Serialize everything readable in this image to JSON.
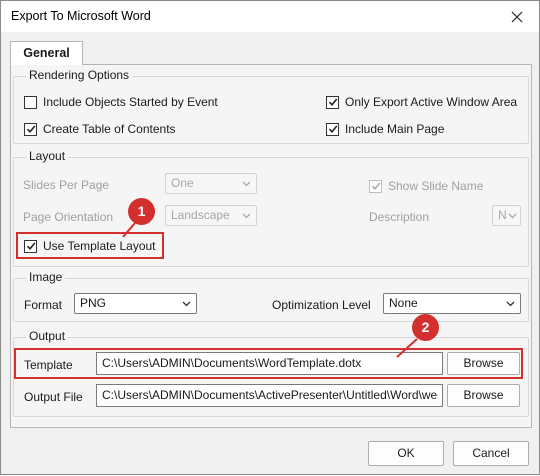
{
  "window": {
    "title": "Export To Microsoft Word"
  },
  "tabs": [
    {
      "label": "General"
    }
  ],
  "rendering": {
    "title": "Rendering Options",
    "include_objects": {
      "label": "Include Objects Started by Event",
      "checked": false
    },
    "only_active_window": {
      "label": "Only Export Active Window Area",
      "checked": true
    },
    "create_toc": {
      "label": "Create Table of Contents",
      "checked": true
    },
    "include_main_page": {
      "label": "Include Main Page",
      "checked": true
    }
  },
  "layout": {
    "title": "Layout",
    "slides_per_page": {
      "label": "Slides Per Page",
      "value": "One"
    },
    "show_slide_name": {
      "label": "Show Slide Name",
      "checked": true
    },
    "page_orientation": {
      "label": "Page Orientation",
      "value": "Landscape"
    },
    "description": {
      "label": "Description",
      "value": "N"
    },
    "use_template_layout": {
      "label": "Use Template Layout",
      "checked": true
    }
  },
  "image": {
    "title": "Image",
    "format": {
      "label": "Format",
      "value": "PNG"
    },
    "optimization": {
      "label": "Optimization Level",
      "value": "None"
    }
  },
  "output": {
    "title": "Output",
    "template": {
      "label": "Template",
      "value": "C:\\Users\\ADMIN\\Documents\\WordTemplate.dotx",
      "button": "Browse"
    },
    "output_file": {
      "label": "Output File",
      "value": "C:\\Users\\ADMIN\\Documents\\ActivePresenter\\Untitled\\Word\\we",
      "button": "Browse"
    }
  },
  "footer": {
    "ok": "OK",
    "cancel": "Cancel"
  },
  "annotations": {
    "badge1": "1",
    "badge2": "2",
    "accent": "#d32f2f"
  }
}
